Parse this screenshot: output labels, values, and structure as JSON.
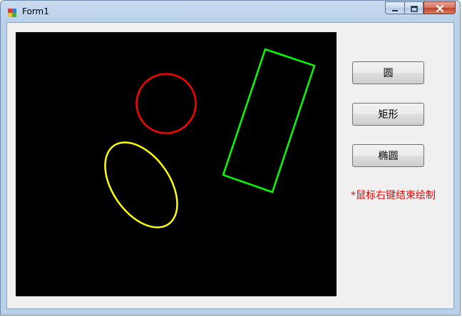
{
  "window": {
    "title": "Form1"
  },
  "buttons": {
    "circle_label": "圆",
    "rectangle_label": "矩形",
    "ellipse_label": "椭圆"
  },
  "hint": {
    "text": "*鼠标右键结束绘制"
  },
  "canvas": {
    "background": "#000000",
    "shapes": [
      {
        "kind": "circle",
        "color": "#ff0000"
      },
      {
        "kind": "rectangle",
        "color": "#00ff00"
      },
      {
        "kind": "ellipse",
        "color": "#ffff00"
      }
    ]
  },
  "colors": {
    "hint": "#ff0000",
    "window_frame": "#b9d0ea",
    "client_bg": "#f0f0f0"
  }
}
